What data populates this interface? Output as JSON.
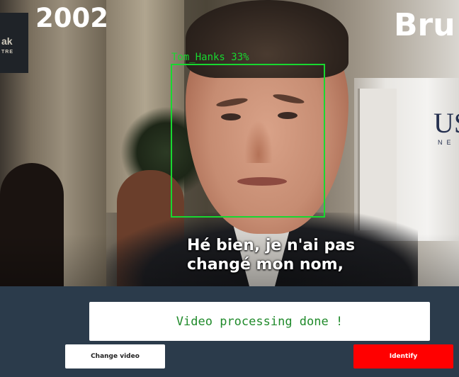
{
  "video": {
    "overlay_year": "2002",
    "overlay_brand": "Bru",
    "background_sign_left": "ak",
    "background_sign_left_sub": "TRE",
    "background_panel_text": "US",
    "background_panel_sub": "NE",
    "detection": {
      "label": "Tom_Hanks 33%",
      "color": "#18d830"
    },
    "subtitle_lines": [
      "Hé bien, je n'ai pas",
      "changé mon nom,"
    ]
  },
  "status": {
    "message": "Video processing done !",
    "color": "#1f8a2a"
  },
  "controls": {
    "change_video_label": "Change video",
    "identify_label": "Identify",
    "identify_color": "#ff0000"
  },
  "theme": {
    "panel_background": "#2b3b4b"
  }
}
